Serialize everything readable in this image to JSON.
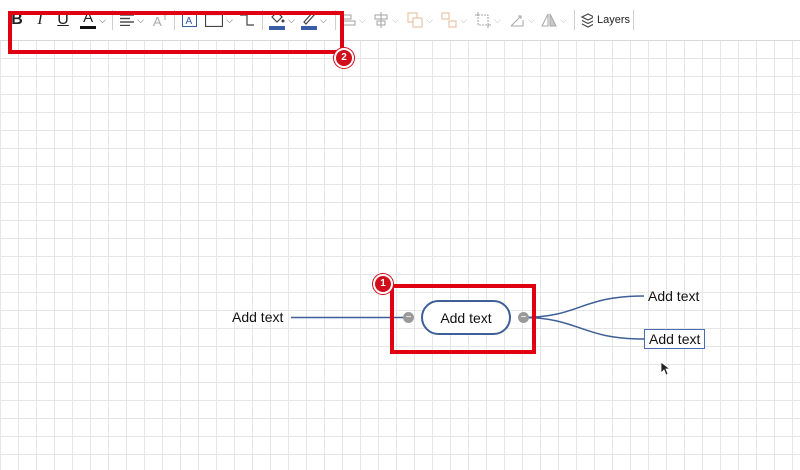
{
  "toolbar": {
    "bold": "B",
    "italic": "I",
    "underline": "U",
    "font_color": "A",
    "chevron": "⌵",
    "layers_label": "Layers"
  },
  "canvas": {
    "central_topic": "Add text",
    "left_topic": "Add text",
    "right_topic_top": "Add text",
    "right_topic_bottom": "Add text",
    "collapse_symbol": "−"
  },
  "callouts": {
    "marker_1": "1",
    "marker_2": "2"
  },
  "colors": {
    "callout_red": "#e00012",
    "connector_blue": "#3e5f97",
    "fill_swatch": "#3b5ba5"
  }
}
